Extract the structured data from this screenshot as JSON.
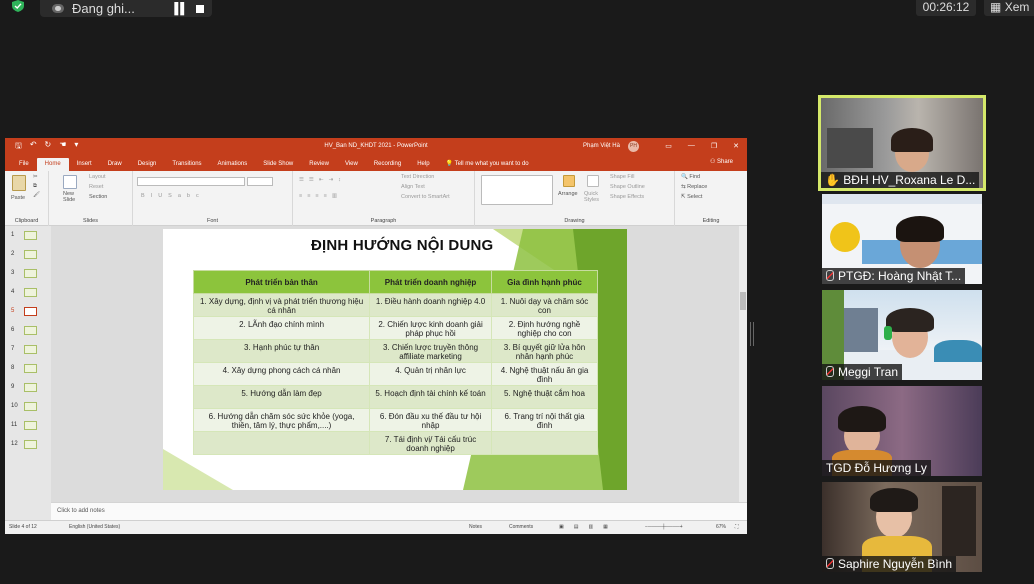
{
  "zoom": {
    "recording_label": "Đang ghi...",
    "timer": "00:26:12",
    "view_label": "Xem"
  },
  "ppt": {
    "window_title": "HV_Ban ND_KHDT 2021  -  PowerPoint",
    "user_name": "Phạm Việt Hà",
    "user_initials": "PH",
    "tabs": [
      "File",
      "Home",
      "Insert",
      "Draw",
      "Design",
      "Transitions",
      "Animations",
      "Slide Show",
      "Review",
      "View",
      "Recording",
      "Help"
    ],
    "tell_me": "Tell me what you want to do",
    "share": "Share",
    "ribbon": {
      "clipboard": "Clipboard",
      "paste": "Paste",
      "slides": "Slides",
      "new_slide": "New Slide",
      "layout": "Layout",
      "reset": "Reset",
      "section": "Section",
      "font": "Font",
      "paragraph": "Paragraph",
      "text_direction": "Text Direction",
      "align_text": "Align Text",
      "convert_smartart": "Convert to SmartArt",
      "drawing": "Drawing",
      "arrange": "Arrange",
      "quick_styles": "Quick Styles",
      "shape_fill": "Shape Fill",
      "shape_outline": "Shape Outline",
      "shape_effects": "Shape Effects",
      "editing": "Editing",
      "find": "Find",
      "replace": "Replace",
      "select": "Select"
    },
    "thumbnails": [
      "1",
      "2",
      "3",
      "4",
      "5",
      "6",
      "7",
      "8",
      "9",
      "10",
      "11",
      "12"
    ],
    "selected_slide": "5",
    "slide": {
      "title": "ĐỊNH HƯỚNG NỘI DUNG",
      "headers": [
        "Phát triển bản thân",
        "Phát triển doanh nghiệp",
        "Gia đình hạnh phúc"
      ],
      "rows": [
        [
          "1. Xây dựng, định vị và phát triển thương hiệu cá nhân",
          "1. Điều hành doanh nghiệp 4.0",
          "1. Nuôi dạy và chăm sóc con"
        ],
        [
          "2. LÃnh đạo chính mình",
          "2. Chiến lược kinh doanh giải pháp phục hồi",
          "2. Định hướng nghề nghiệp cho con"
        ],
        [
          "3. Hạnh phúc tự thân",
          "3. Chiến lược truyền thông affiliate marketing",
          "3. Bí quyết giữ lửa hôn nhân hạnh phúc"
        ],
        [
          "4. Xây dựng phong cách cá nhân",
          "4. Quản trị nhân lực",
          "4. Nghệ thuật nấu ăn gia đình"
        ],
        [
          "5. Hướng dẫn làm đẹp",
          "5. Hoạch định tài chính kế toán",
          "5. Nghệ thuật cắm hoa"
        ],
        [
          "6. Hướng dẫn chăm sóc sức khỏe (yoga, thiền, tâm lý, thực phẩm,....)",
          "6. Đón đầu xu thế đầu tư hội nhập",
          "6. Trang trí nội thất gia đình"
        ],
        [
          "",
          "7. Tái định vị/ Tái cấu trúc doanh nghiệp",
          ""
        ]
      ]
    },
    "notes_placeholder": "Click to add notes",
    "status": {
      "slide_info": "Slide 4 of 12",
      "language": "English (United States)",
      "notes": "Notes",
      "comments": "Comments",
      "zoom": "67%"
    }
  },
  "participants": [
    {
      "name": "BĐH HV_Roxana Le D...",
      "active": true
    },
    {
      "name": "PTGĐ: Hoàng Nhật T...",
      "active": false
    },
    {
      "name": "Meggi Tran",
      "active": false
    },
    {
      "name": "TGD Đỗ Hương Ly",
      "active": false
    },
    {
      "name": "Saphire Nguyễn Bình",
      "active": false
    }
  ],
  "colors": {
    "ppt_accent": "#c43e1c",
    "table_header": "#8cc43c",
    "active_speaker_border": "#d5e96a"
  }
}
